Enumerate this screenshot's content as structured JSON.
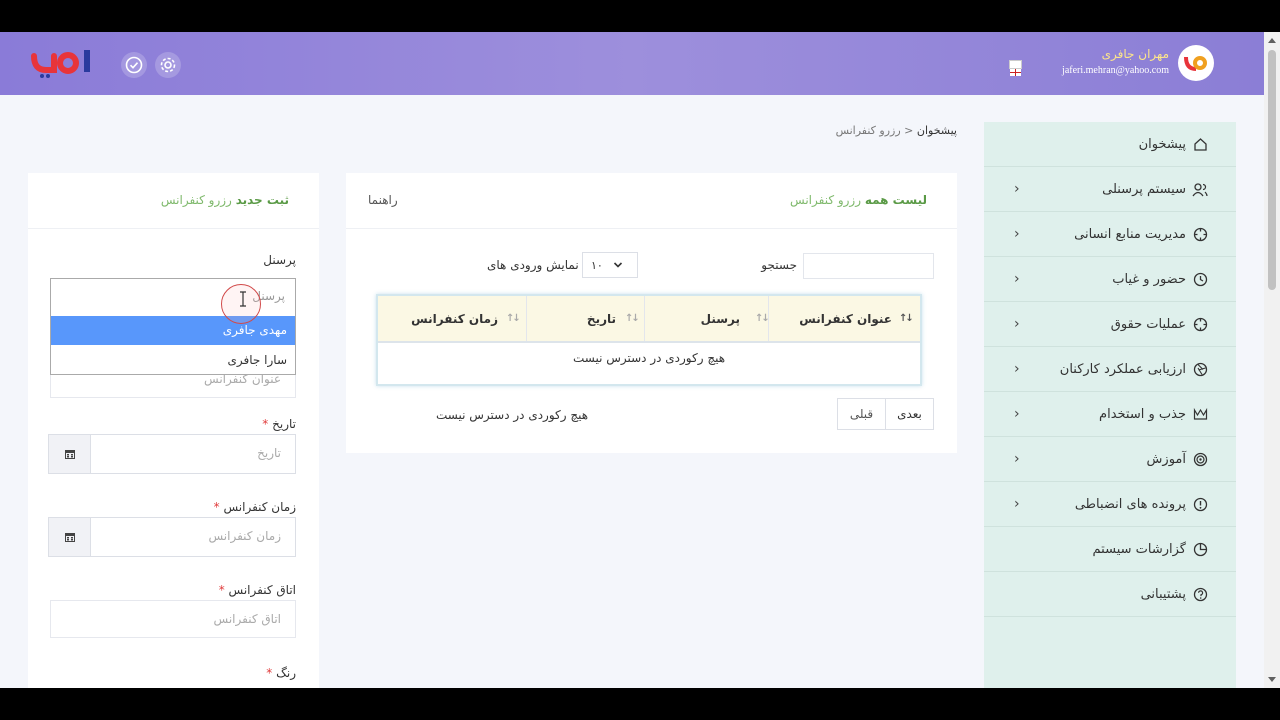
{
  "header": {
    "user_name": "مهران جافری",
    "user_email": "jaferi.mehran@yahoo.com",
    "logo_text": "ایدو",
    "brand_colors": {
      "bar": "#9386da",
      "logo_red": "#e8343a",
      "logo_blue": "#2a3a9e"
    }
  },
  "sidebar": {
    "items": [
      {
        "label": "پیشخوان",
        "icon": "home-icon",
        "has_chevron": false
      },
      {
        "label": "سیستم پرسنلی",
        "icon": "users-icon",
        "has_chevron": true
      },
      {
        "label": "مدیریت منابع انسانی",
        "icon": "crosshair-icon",
        "has_chevron": true
      },
      {
        "label": "حضور و غیاب",
        "icon": "clock-icon",
        "has_chevron": true
      },
      {
        "label": "عملیات حقوق",
        "icon": "crosshair-icon",
        "has_chevron": true
      },
      {
        "label": "ارزیابی عملکرد کارکنان",
        "icon": "aperture-icon",
        "has_chevron": true
      },
      {
        "label": "جذب و استخدام",
        "icon": "crown-icon",
        "has_chevron": true
      },
      {
        "label": "آموزش",
        "icon": "target-icon",
        "has_chevron": true
      },
      {
        "label": "پرونده های انضباطی",
        "icon": "alert-circle-icon",
        "has_chevron": true
      },
      {
        "label": "گزارشات سیستم",
        "icon": "pie-chart-icon",
        "has_chevron": false
      },
      {
        "label": "پشتیبانی",
        "icon": "help-circle-icon",
        "has_chevron": false
      }
    ]
  },
  "breadcrumb": {
    "home": "پیشخوان",
    "separator": "<",
    "current": "رزرو کنفرانس"
  },
  "list_card": {
    "title_bold": "لیست همه",
    "title_rest": "رزرو کنفرانس",
    "help": "راهنما",
    "search_label": "جستجو",
    "entries_value": "۱۰",
    "entries_label": "نمایش ورودی های",
    "columns": [
      "عنوان کنفرانس",
      "پرسنل",
      "تاریخ",
      "زمان کنفرانس"
    ],
    "empty_text": "هیچ رکوردی در دسترس نیست",
    "info_text": "هیچ رکوردی در دسترس نیست",
    "next": "بعدی",
    "prev": "قبلی"
  },
  "form_card": {
    "title_bold": "ثبت جدید",
    "title_rest": "رزرو کنفرانس",
    "personnel_label": "پرسنل",
    "dropdown_search_placeholder": "پرسنل",
    "options": [
      "مهدی جافری",
      "سارا جافری"
    ],
    "conference_title_placeholder": "عنوان کنفرانس",
    "date_label": "تاریخ",
    "date_placeholder": "تاریخ",
    "time_label": "زمان کنفرانس",
    "time_placeholder": "زمان کنفرانس",
    "room_label": "اتاق کنفرانس",
    "room_placeholder": "اتاق کنفرانس",
    "color_label": "رنگ",
    "required_mark": "*"
  }
}
